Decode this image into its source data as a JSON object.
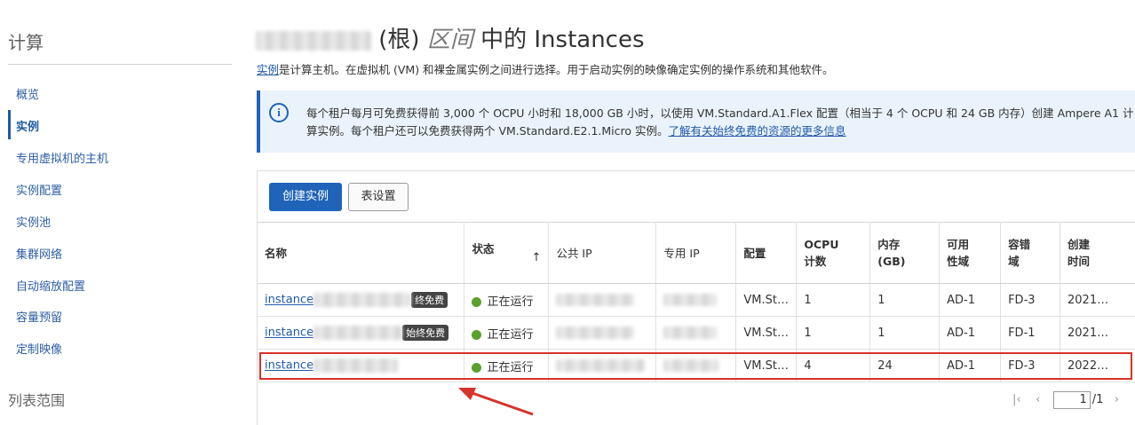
{
  "sidebar": {
    "title": "计算",
    "items": [
      {
        "label": "概览",
        "active": false
      },
      {
        "label": "实例",
        "active": true
      },
      {
        "label": "专用虚拟机的主机",
        "active": false
      },
      {
        "label": "实例配置",
        "active": false
      },
      {
        "label": "实例池",
        "active": false
      },
      {
        "label": "集群网络",
        "active": false
      },
      {
        "label": "自动缩放配置",
        "active": false
      },
      {
        "label": "容量预留",
        "active": false
      },
      {
        "label": "定制映像",
        "active": false
      }
    ],
    "scope_label": "列表范围"
  },
  "header": {
    "title_root": "(根)",
    "title_italic": "区间",
    "title_rest": "中的 Instances",
    "description_link": "实例",
    "description_rest": "是计算主机。在虚拟机 (VM) 和裸金属实例之间进行选择。用于启动实例的映像确定实例的操作系统和其他软件。"
  },
  "info": {
    "icon": "info-icon",
    "text": "每个租户每月可免费获得前 3,000 个 OCPU 小时和 18,000 GB 小时，以使用 VM.Standard.A1.Flex 配置（相当于 4 个 OCPU 和 24 GB 内存）创建 Ampere A1 计算实例。每个租户还可以免费获得两个 VM.Standard.E2.1.Micro 实例。",
    "link": "了解有关始终免费的资源的更多信息"
  },
  "toolbar": {
    "create_label": "创建实例",
    "settings_label": "表设置"
  },
  "table": {
    "headers": {
      "name": "名称",
      "status": "状态",
      "public_ip": "公共 IP",
      "private_ip": "专用 IP",
      "shape": "配置",
      "ocpu_1": "OCPU",
      "ocpu_2": "计数",
      "mem_1": "内存",
      "mem_2": "(GB)",
      "ad_1": "可用",
      "ad_2": "性域",
      "fd_1": "容错",
      "fd_2": "域",
      "created_1": "创建",
      "created_2": "时间"
    },
    "rows": [
      {
        "name": "instance",
        "badge": "终免费",
        "status": "正在运行",
        "shape": "VM.St…",
        "ocpu": "1",
        "memory": "1",
        "ad": "AD-1",
        "fd": "FD-3",
        "created": "2021…"
      },
      {
        "name": "instance",
        "badge": "始终免费",
        "status": "正在运行",
        "shape": "VM.St…",
        "ocpu": "1",
        "memory": "1",
        "ad": "AD-1",
        "fd": "FD-1",
        "created": "2021…"
      },
      {
        "name": "instance",
        "badge": "",
        "status": "正在运行",
        "shape": "VM.St…",
        "ocpu": "4",
        "memory": "24",
        "ad": "AD-1",
        "fd": "FD-3",
        "created": "2022…"
      }
    ],
    "status_color": "#5aa02c",
    "highlight_color": "#d9312b"
  },
  "pager": {
    "first_icon": "first-page-icon",
    "prev_icon": "prev-page-icon",
    "next_icon": "next-page-icon",
    "page_value": "1",
    "total": "/1"
  },
  "colors": {
    "primary": "#1f64b9",
    "link": "#1f5aa8",
    "annotation_arrow": "#d9312b"
  }
}
